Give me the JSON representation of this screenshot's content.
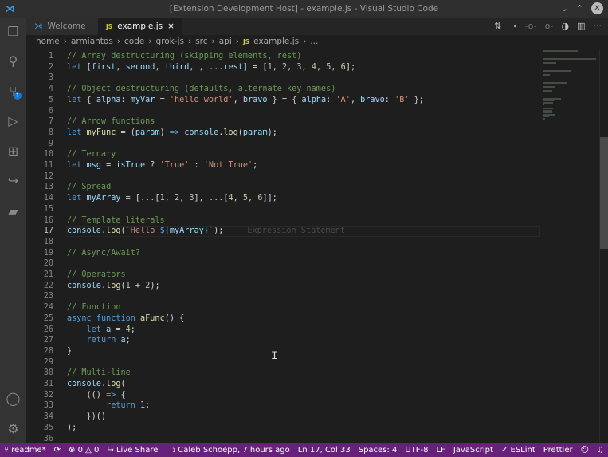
{
  "window": {
    "title": "[Extension Development Host] - example.js - Visual Studio Code"
  },
  "activity": {
    "scm_badge": "1"
  },
  "tabs": [
    {
      "label": "Welcome"
    },
    {
      "label": "example.js",
      "icon": "JS",
      "close": "×"
    }
  ],
  "breadcrumb": [
    "home",
    "armiantos",
    "code",
    "grok-js",
    "src",
    "api",
    "example.js",
    "..."
  ],
  "editor": {
    "current_line": 17,
    "ghost_text": "Expression Statement",
    "lines": [
      [
        [
          "// Array destructuring (skipping elements, rest)",
          "c"
        ]
      ],
      [
        [
          "let",
          "k"
        ],
        [
          " [",
          ""
        ],
        [
          "first",
          "v"
        ],
        [
          ", ",
          ""
        ],
        [
          "second",
          "v"
        ],
        [
          ", ",
          ""
        ],
        [
          "third",
          "v"
        ],
        [
          ", , ...",
          ""
        ],
        [
          "rest",
          "v"
        ],
        [
          "] = [",
          ""
        ],
        [
          "1",
          "n"
        ],
        [
          ", ",
          ""
        ],
        [
          "2",
          "n"
        ],
        [
          ", ",
          ""
        ],
        [
          "3",
          "n"
        ],
        [
          ", ",
          ""
        ],
        [
          "4",
          "n"
        ],
        [
          ", ",
          ""
        ],
        [
          "5",
          "n"
        ],
        [
          ", ",
          ""
        ],
        [
          "6",
          "n"
        ],
        [
          "];",
          ""
        ]
      ],
      [],
      [
        [
          "// Object destructuring (defaults, alternate key names)",
          "c"
        ]
      ],
      [
        [
          "let",
          "k"
        ],
        [
          " { ",
          ""
        ],
        [
          "alpha",
          "v"
        ],
        [
          ": ",
          ""
        ],
        [
          "myVar",
          "v"
        ],
        [
          " = ",
          ""
        ],
        [
          "'hello world'",
          "s"
        ],
        [
          ", ",
          ""
        ],
        [
          "bravo",
          "v"
        ],
        [
          " } = { ",
          ""
        ],
        [
          "alpha",
          "v"
        ],
        [
          ": ",
          ""
        ],
        [
          "'A'",
          "s"
        ],
        [
          ", ",
          ""
        ],
        [
          "bravo",
          "v"
        ],
        [
          ": ",
          ""
        ],
        [
          "'B'",
          "s"
        ],
        [
          " };",
          ""
        ]
      ],
      [],
      [
        [
          "// Arrow functions",
          "c"
        ]
      ],
      [
        [
          "let",
          "k"
        ],
        [
          " ",
          ""
        ],
        [
          "myFunc",
          "f"
        ],
        [
          " = (",
          ""
        ],
        [
          "param",
          "v"
        ],
        [
          ") ",
          ""
        ],
        [
          "=>",
          "k"
        ],
        [
          " ",
          ""
        ],
        [
          "console",
          "v"
        ],
        [
          ".",
          ""
        ],
        [
          "log",
          "f"
        ],
        [
          "(",
          ""
        ],
        [
          "param",
          "v"
        ],
        [
          ");",
          ""
        ]
      ],
      [],
      [
        [
          "// Ternary",
          "c"
        ]
      ],
      [
        [
          "let",
          "k"
        ],
        [
          " ",
          ""
        ],
        [
          "msg",
          "v"
        ],
        [
          " = ",
          ""
        ],
        [
          "isTrue",
          "v"
        ],
        [
          " ? ",
          ""
        ],
        [
          "'True'",
          "s"
        ],
        [
          " : ",
          ""
        ],
        [
          "'Not True'",
          "s"
        ],
        [
          ";",
          ""
        ]
      ],
      [],
      [
        [
          "// Spread",
          "c"
        ]
      ],
      [
        [
          "let",
          "k"
        ],
        [
          " ",
          ""
        ],
        [
          "myArray",
          "v"
        ],
        [
          " = [...[",
          ""
        ],
        [
          "1",
          "n"
        ],
        [
          ", ",
          ""
        ],
        [
          "2",
          "n"
        ],
        [
          ", ",
          ""
        ],
        [
          "3",
          "n"
        ],
        [
          "], ...[",
          ""
        ],
        [
          "4",
          "n"
        ],
        [
          ", ",
          ""
        ],
        [
          "5",
          "n"
        ],
        [
          ", ",
          ""
        ],
        [
          "6",
          "n"
        ],
        [
          "]];",
          ""
        ]
      ],
      [],
      [
        [
          "// Template literals",
          "c"
        ]
      ],
      [
        [
          "console",
          "v"
        ],
        [
          ".",
          ""
        ],
        [
          "log",
          "f"
        ],
        [
          "(",
          ""
        ],
        [
          "`Hello ",
          "s"
        ],
        [
          "${",
          "k"
        ],
        [
          "myArray",
          "v"
        ],
        [
          "}",
          "k"
        ],
        [
          "`",
          "s"
        ],
        [
          ");",
          ""
        ]
      ],
      [],
      [
        [
          "// Async/Await?",
          "c"
        ]
      ],
      [],
      [
        [
          "// Operators",
          "c"
        ]
      ],
      [
        [
          "console",
          "v"
        ],
        [
          ".",
          ""
        ],
        [
          "log",
          "f"
        ],
        [
          "(",
          ""
        ],
        [
          "1",
          "n"
        ],
        [
          " + ",
          ""
        ],
        [
          "2",
          "n"
        ],
        [
          ");",
          ""
        ]
      ],
      [],
      [
        [
          "// Function",
          "c"
        ]
      ],
      [
        [
          "async",
          "k"
        ],
        [
          " ",
          ""
        ],
        [
          "function",
          "k"
        ],
        [
          " ",
          ""
        ],
        [
          "aFunc",
          "f"
        ],
        [
          "() {",
          ""
        ]
      ],
      [
        [
          "    ",
          ""
        ],
        [
          "let",
          "k"
        ],
        [
          " ",
          ""
        ],
        [
          "a",
          "v"
        ],
        [
          " = ",
          ""
        ],
        [
          "4",
          "n"
        ],
        [
          ";",
          ""
        ]
      ],
      [
        [
          "    ",
          ""
        ],
        [
          "return",
          "k"
        ],
        [
          " ",
          ""
        ],
        [
          "a",
          "v"
        ],
        [
          ";",
          ""
        ]
      ],
      [
        [
          "}",
          ""
        ]
      ],
      [],
      [
        [
          "// Multi-line",
          "c"
        ]
      ],
      [
        [
          "console",
          "v"
        ],
        [
          ".",
          ""
        ],
        [
          "log",
          "f"
        ],
        [
          "(",
          ""
        ]
      ],
      [
        [
          "    (() ",
          ""
        ],
        [
          "=>",
          "k"
        ],
        [
          " {",
          ""
        ]
      ],
      [
        [
          "        ",
          ""
        ],
        [
          "return",
          "k"
        ],
        [
          " ",
          ""
        ],
        [
          "1",
          "n"
        ],
        [
          ";",
          ""
        ]
      ],
      [
        [
          "    })()",
          ""
        ]
      ],
      [
        [
          ");",
          ""
        ]
      ],
      []
    ]
  },
  "status": {
    "branch": "readme*",
    "sync": "⟳",
    "errors": "0",
    "warnings": "0",
    "liveshare": "Live Share",
    "blame": "Caleb Schoepp, 7 hours ago",
    "position": "Ln 17, Col 33",
    "spaces": "Spaces: 4",
    "encoding": "UTF-8",
    "eol": "LF",
    "language": "JavaScript",
    "eslint": "ESLint",
    "prettier": "Prettier"
  }
}
